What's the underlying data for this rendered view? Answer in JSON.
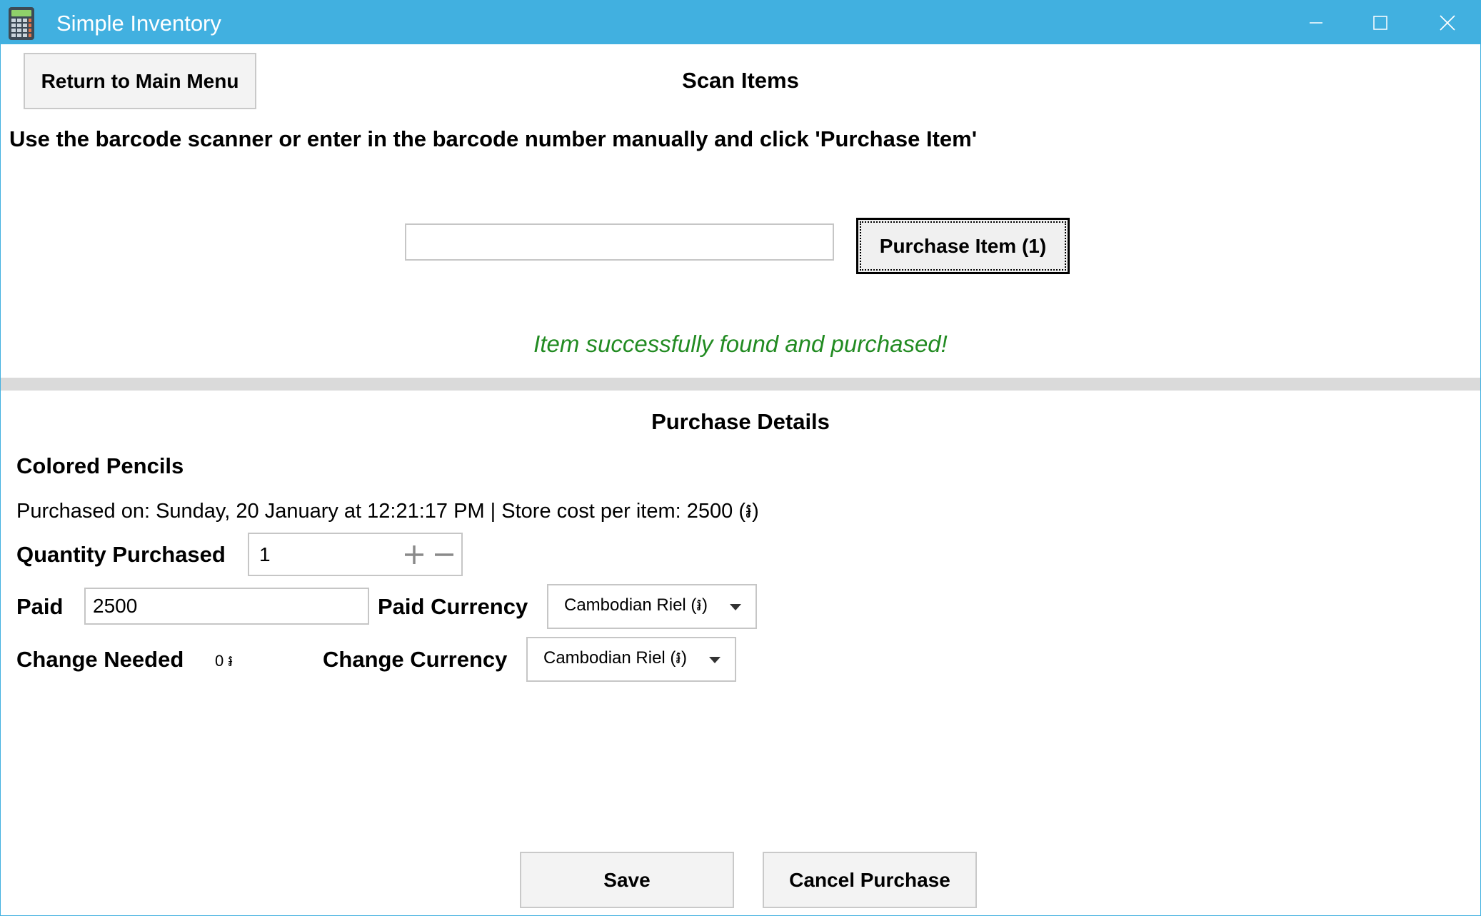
{
  "window": {
    "title": "Simple Inventory",
    "title_bar_color": "#41b0e0",
    "icon": "calculator-icon",
    "controls": [
      "minimize-icon",
      "maximize-icon",
      "close-icon"
    ]
  },
  "scan": {
    "return_button_label": "Return to Main Menu",
    "heading": "Scan Items",
    "instructions": "Use the barcode scanner or enter in the barcode number manually and click 'Purchase Item'",
    "barcode_value": "",
    "purchase_button_label": "Purchase Item (1)",
    "status_message": "Item successfully found and purchased!",
    "status_color": "#228b22"
  },
  "details": {
    "heading": "Purchase Details",
    "item_name": "Colored Pencils",
    "purchase_info": "Purchased on: Sunday, 20 January at 12:21:17 PM | Store cost per item: 2500 (៛)",
    "quantity_label": "Quantity Purchased",
    "quantity_value": "1",
    "paid_label": "Paid",
    "paid_value": "2500",
    "paid_currency_label": "Paid Currency",
    "paid_currency_value": "Cambodian Riel (៛)",
    "change_label": "Change Needed",
    "change_value": "0 ៛",
    "change_currency_label": "Change Currency",
    "change_currency_value": "Cambodian Riel (៛)"
  },
  "footer": {
    "save_label": "Save",
    "cancel_label": "Cancel Purchase"
  }
}
